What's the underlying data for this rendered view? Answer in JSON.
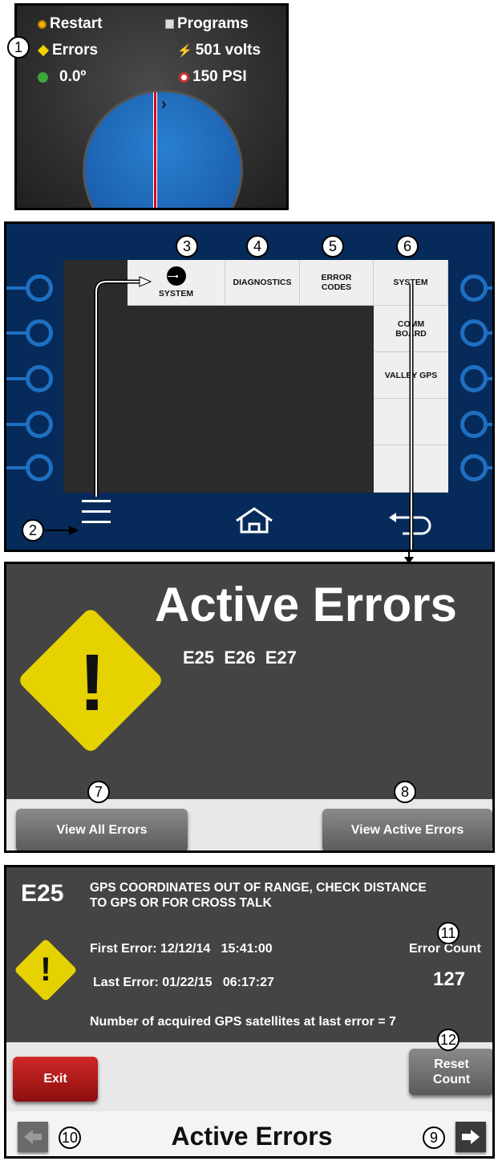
{
  "status_panel": {
    "restart": "Restart",
    "programs": "Programs",
    "errors": "Errors",
    "voltage": "501 volts",
    "angle": "0.0º",
    "pressure": "150 PSI"
  },
  "menu": {
    "system_tile": "SYSTEM",
    "diagnostics": "DIAGNOSTICS",
    "error_codes_line1": "ERROR",
    "error_codes_line2": "CODES",
    "system": "SYSTEM",
    "comm_board_line1": "COMM",
    "comm_board_line2": "BOARD",
    "valley_gps": "VALLEY GPS"
  },
  "active_errors_screen": {
    "title": "Active Errors",
    "codes": "E25  E26  E27",
    "view_all": "View All Errors",
    "view_active": "View Active Errors"
  },
  "error_detail": {
    "code": "E25",
    "description_line1": "GPS COORDINATES OUT OF RANGE, CHECK DISTANCE",
    "description_line2": "TO GPS OR FOR CROSS TALK",
    "first_error": "First Error: 12/12/14   15:41:00",
    "last_error": "Last Error: 01/22/15   06:17:27",
    "error_count_label": "Error Count",
    "error_count": "127",
    "gps_note": "Number of acquired GPS satellites at last error = 7",
    "exit": "Exit",
    "reset_line1": "Reset",
    "reset_line2": "Count",
    "footer_title": "Active Errors"
  },
  "callouts": [
    "1",
    "2",
    "3",
    "4",
    "5",
    "6",
    "7",
    "8",
    "9",
    "10",
    "11",
    "12"
  ],
  "colors": {
    "knob_blue": "#1e6fc0",
    "panel_navy": "#062a5a",
    "warning_yellow": "#e6d200",
    "exit_red": "#b51c1c"
  }
}
